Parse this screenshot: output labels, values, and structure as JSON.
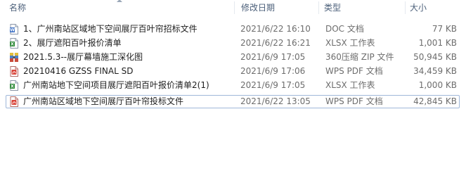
{
  "columns": {
    "name": "名称",
    "date": "修改日期",
    "type": "类型",
    "size": "大小"
  },
  "files": [
    {
      "name": "1、广州南站区域地下空间展厅百叶帘招标文件",
      "date": "2021/6/22 16:10",
      "type": "DOC 文档",
      "size": "77 KB",
      "icon": "word-doc-icon"
    },
    {
      "name": "2、展厅遮阳百叶报价清单",
      "date": "2021/6/22 16:21",
      "type": "XLSX 工作表",
      "size": "1,001 KB",
      "icon": "excel-xlsx-icon"
    },
    {
      "name": "2021.5.3--展厅幕墙施工深化图",
      "date": "2021/6/9 17:05",
      "type": "360压缩 ZIP 文件",
      "size": "50,945 KB",
      "icon": "zip-archive-icon"
    },
    {
      "name": "20210416 GZSS FINAL SD",
      "date": "2021/6/9 17:06",
      "type": "WPS PDF 文档",
      "size": "34,459 KB",
      "icon": "pdf-icon"
    },
    {
      "name": "广州南站地下空间项目展厅遮阳百叶报价清单2(1)",
      "date": "2021/6/9 17:05",
      "type": "XLSX 工作表",
      "size": "1,000 KB",
      "icon": "excel-xlsx-icon"
    },
    {
      "name": "广州南站区域地下空间展厅百叶帘投标文件",
      "date": "2021/6/22 13:05",
      "type": "WPS PDF 文档",
      "size": "42,845 KB",
      "icon": "pdf-icon",
      "selected": true
    }
  ],
  "colors": {
    "header_text": "#4c607a",
    "selection_border": "#9fb7d9",
    "pdf_red": "#d9443a",
    "excel_green": "#2f8a3b",
    "word_blue": "#3b6fc4"
  }
}
